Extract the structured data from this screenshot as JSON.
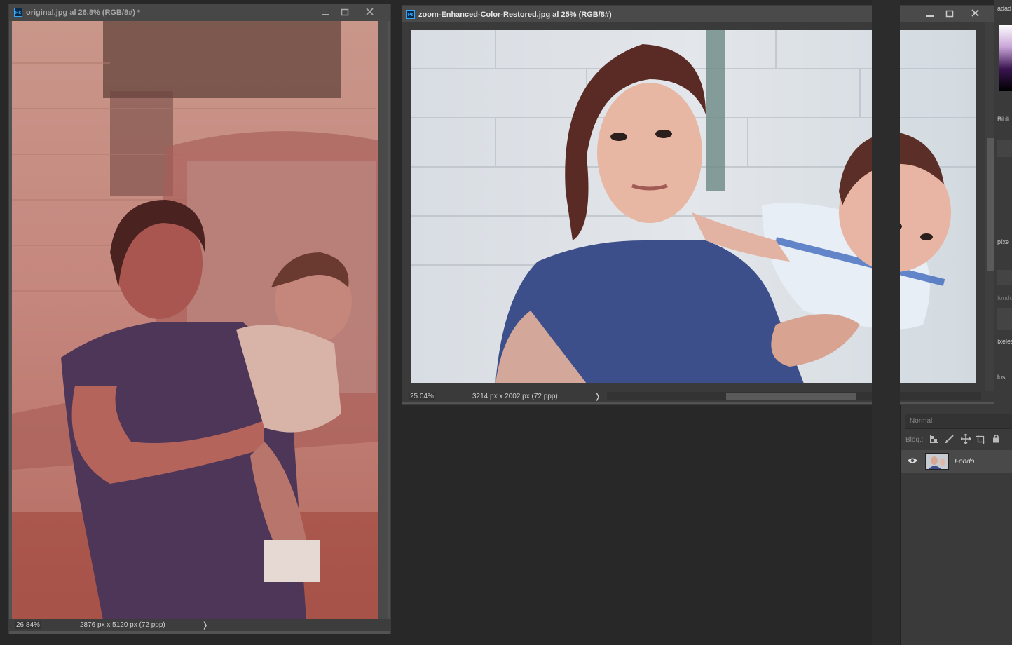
{
  "app": "Adobe Photoshop",
  "left_window": {
    "title": "original.jpg al 26.8% (RGB/8#) *",
    "zoom": "26.84%",
    "doc_info": "2876 px x 5120 px (72 ppp)"
  },
  "right_window": {
    "title": "zoom-Enhanced-Color-Restored.jpg al 25% (RGB/8#)",
    "zoom": "25.04%",
    "doc_info": "3214 px x 2002 px (72 ppp)"
  },
  "side_strip": {
    "labels": [
      "adad",
      "Bibli",
      "píxe",
      "fondo",
      "íxeles",
      "los"
    ]
  },
  "layers_panel": {
    "blend_mode": "Normal",
    "lock_label": "Bloq.:",
    "layer_name": "Fondo"
  },
  "colors": {
    "app_bg": "#282828",
    "panel_bg": "#535353",
    "accent": "#31a8ff"
  },
  "icons": [
    "photoshop-icon",
    "minimize-icon",
    "maximize-icon",
    "close-icon",
    "chevron-right-icon",
    "eye-icon",
    "lock-transparent-icon",
    "brush-icon",
    "move-icon",
    "artboard-icon",
    "lock-icon"
  ]
}
